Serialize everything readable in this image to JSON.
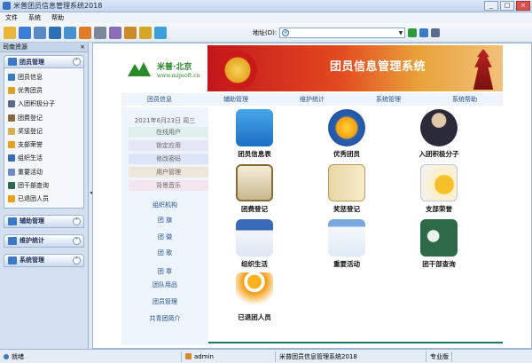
{
  "window": {
    "title": "米普团员信息管理系统2018",
    "buttons": {
      "minimize": "_",
      "maximize": "□",
      "close": "×"
    }
  },
  "menu": [
    "文件",
    "系统",
    "帮助"
  ],
  "address": {
    "label": "地址(D):"
  },
  "left_panel": {
    "title": "司南资源",
    "groups": [
      {
        "title": "团员管理",
        "items": [
          "团员信息",
          "优秀团员",
          "入团积极分子",
          "团费登记",
          "奖惩登记",
          "支部荣誉",
          "组织生活",
          "重要活动",
          "团干部查询",
          "已退团人员"
        ]
      },
      {
        "title": "辅助管理"
      },
      {
        "title": "维护统计"
      },
      {
        "title": "系统管理"
      }
    ]
  },
  "banner": {
    "brand": "米普·北京",
    "url": "www.mipsoft.cn",
    "title": "团员信息管理系统"
  },
  "navbar": [
    "团员信息",
    "辅助管理",
    "维护统计",
    "系统管理",
    "系统帮助"
  ],
  "sidenav": {
    "date": "2021年6月23日   周三",
    "buttons": [
      "在线用户",
      "锁定应用",
      "修改密码",
      "用户管理",
      "背景音乐"
    ],
    "links": [
      "组织机构",
      "团    旗",
      "团    徽",
      "团    歌",
      "团    章",
      "团队用品",
      "团员管理",
      "共青团简介"
    ]
  },
  "tiles": [
    "团员信息表",
    "优秀团员",
    "入团积极分子",
    "团费登记",
    "奖惩登记",
    "支部荣誉",
    "组织生活",
    "重要活动",
    "团干部查询",
    "已退团人员"
  ],
  "status": {
    "ready": "就绪",
    "user": "admin",
    "app": "米普团员信息管理系统2018",
    "edition": "专业版"
  },
  "colors": {
    "accent": "#1a7a6a",
    "banner_red": "#c4161c",
    "nav_text": "#1f4f8f"
  }
}
